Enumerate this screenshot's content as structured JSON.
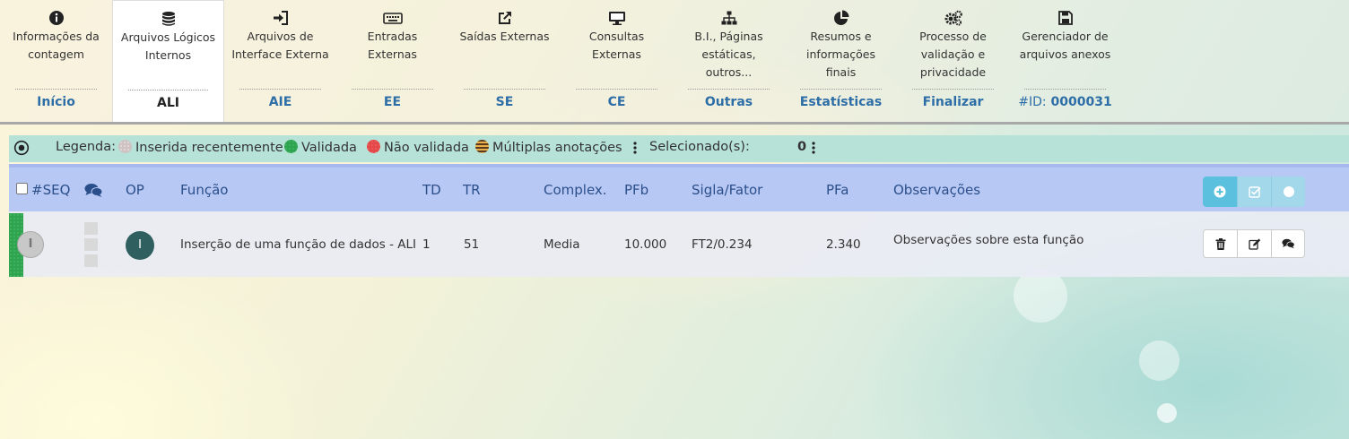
{
  "nav": {
    "tabs": [
      {
        "icon": "info-circle-icon",
        "label": "Informações da contagem",
        "short": "Início"
      },
      {
        "icon": "database-icon",
        "label": "Arquivos Lógicos Internos",
        "short": "ALI"
      },
      {
        "icon": "sign-in-icon",
        "label": "Arquivos de Interface Externa",
        "short": "AIE"
      },
      {
        "icon": "keyboard-icon",
        "label": "Entradas Externas",
        "short": "EE"
      },
      {
        "icon": "external-link-icon",
        "label": "Saídas Externas",
        "short": "SE"
      },
      {
        "icon": "monitor-icon",
        "label": "Consultas Externas",
        "short": "CE"
      },
      {
        "icon": "sitemap-icon",
        "label": "B.I., Páginas estáticas, outros...",
        "short": "Outras"
      },
      {
        "icon": "pie-chart-icon",
        "label": "Resumos e informações finais",
        "short": "Estatísticas"
      },
      {
        "icon": "gears-icon",
        "label": "Processo de validação e privacidade",
        "short": "Finalizar"
      },
      {
        "icon": "save-icon",
        "label": "Gerenciador de arquivos anexos",
        "short_prefix": "#ID:",
        "short": "0000031"
      }
    ]
  },
  "legend": {
    "title": "Legenda:",
    "recent": "Inserida recentemente",
    "validated": "Validada",
    "not_validated": "Não validada",
    "multiple": "Múltiplas anotações",
    "selected_label": "Selecionado(s):",
    "selected_count": "0"
  },
  "table": {
    "headers": {
      "seq": "#SEQ",
      "op": "OP",
      "funcao": "Função",
      "td": "TD",
      "tr": "TR",
      "complex": "Complex.",
      "pfb": "PFb",
      "sigla": "Sigla/Fator",
      "pfa": "PFa",
      "obs": "Observações"
    },
    "rows": [
      {
        "seq": "I",
        "op": "I",
        "funcao": "Inserção de uma função de dados - ALI",
        "td": "1",
        "tr": "51",
        "complex": "Media",
        "pfb": "10.000",
        "sigla": "FT2/0.234",
        "pfa": "2.340",
        "obs": "Observações sobre esta função"
      }
    ]
  },
  "colors": {
    "accent": "#2e6ea7",
    "header_bg": "#b8c8f5",
    "legend_bg": "#b7e2d8",
    "validated": "#2ea44f",
    "info_button": "#5bc0de"
  }
}
